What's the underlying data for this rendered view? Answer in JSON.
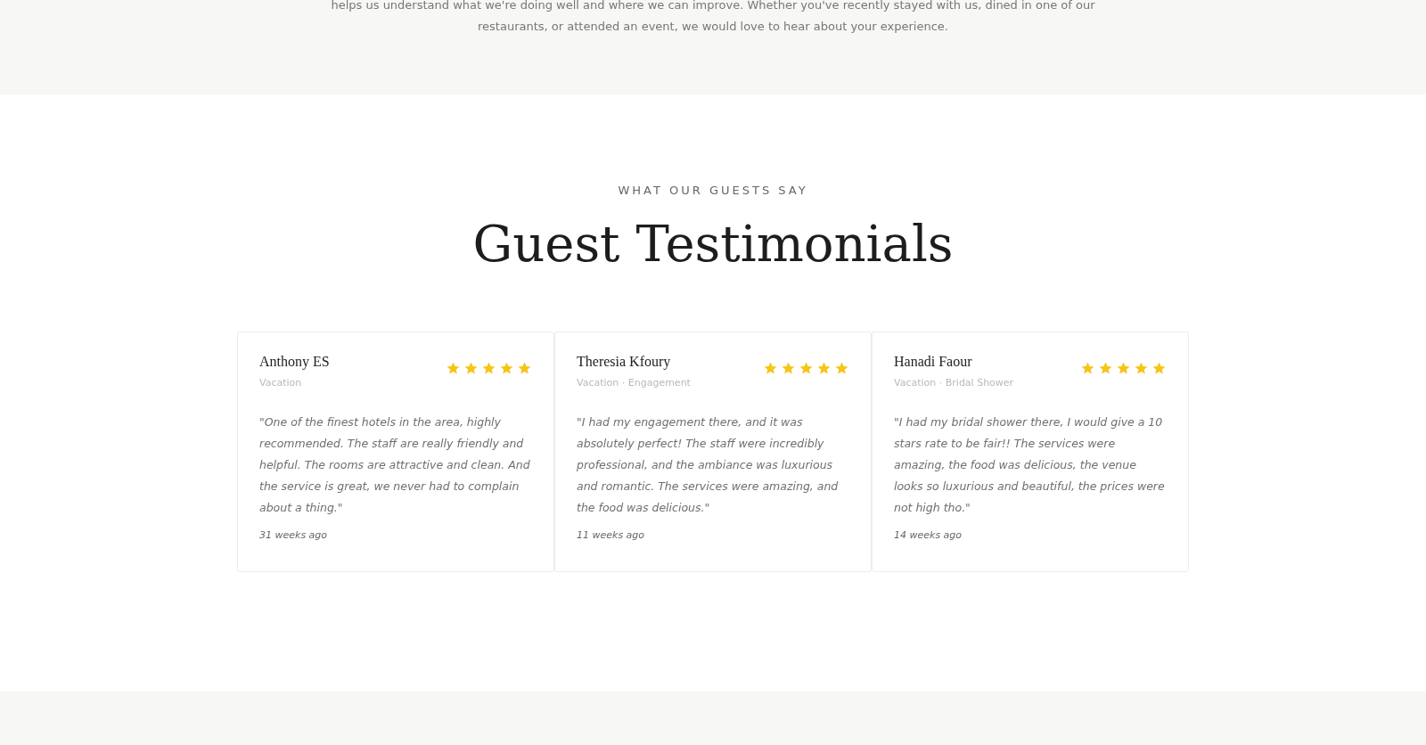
{
  "intro": {
    "lines": [
      "helps us understand what we're doing well and where we can improve. Whether you've recently stayed with us, dined in one of our",
      "restaurants, or attended an event, we would love to hear about your experience."
    ]
  },
  "section": {
    "eyebrow": "WHAT OUR GUESTS SAY",
    "title": "Guest Testimonials"
  },
  "testimonials": [
    {
      "name": "Anthony ES",
      "tags": "Vacation",
      "stars": 5,
      "quote": "\"One of the finest hotels in the area, highly recommended. The staff are really friendly and helpful. The rooms are attractive and clean. And the service is great, we never had to complain about a thing.\"",
      "time": "31 weeks ago"
    },
    {
      "name": "Theresia Kfoury",
      "tags": "Vacation · Engagement",
      "stars": 5,
      "quote": "\"I had my engagement there, and it was absolutely perfect! The staff were incredibly professional, and the ambiance was luxurious and romantic. The services were amazing, and the food was delicious.\"",
      "time": "11 weeks ago"
    },
    {
      "name": "Hanadi Faour",
      "tags": "Vacation · Bridal Shower",
      "stars": 5,
      "quote": "\"I had my bridal shower there, I would give a 10 stars rate to be fair!! The services were amazing, the food was delicious, the venue looks so luxurious and beautiful, the prices were not high tho.\"",
      "time": "14 weeks ago"
    }
  ]
}
